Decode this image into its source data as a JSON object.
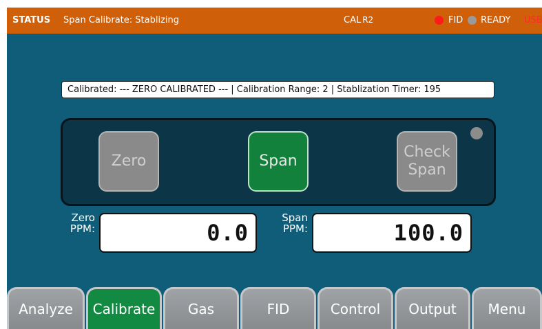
{
  "status": {
    "title": "STATUS",
    "message": "Span Calibrate: Stablizing",
    "cal": "CAL",
    "range": "R2",
    "fid": "FID",
    "ready": "READY",
    "usb": "USB",
    "fid_dot_color": "#ff1a1a",
    "ready_dot_color": "#9a9a9a"
  },
  "info_bar": "Calibrated: --- ZERO CALIBRATED --- | Calibration Range: 2 | Stablization Timer: 195",
  "cal_buttons": {
    "zero": "Zero",
    "span": "Span",
    "check_span_line1": "Check",
    "check_span_line2": "Span",
    "active": "span"
  },
  "readouts": {
    "zero_label_1": "Zero",
    "zero_label_2": "PPM:",
    "zero_value": "0.0",
    "span_label_1": "Span",
    "span_label_2": "PPM:",
    "span_value": "100.0"
  },
  "tabs": [
    {
      "label": "Analyze"
    },
    {
      "label": "Calibrate",
      "active": true
    },
    {
      "label": "Gas"
    },
    {
      "label": "FID"
    },
    {
      "label": "Control"
    },
    {
      "label": "Output"
    },
    {
      "label": "Menu"
    }
  ],
  "colors": {
    "background": "#0f5d78",
    "status_bar": "#cf5f08",
    "active_green": "#12813c",
    "tab_grey": "#939699"
  }
}
